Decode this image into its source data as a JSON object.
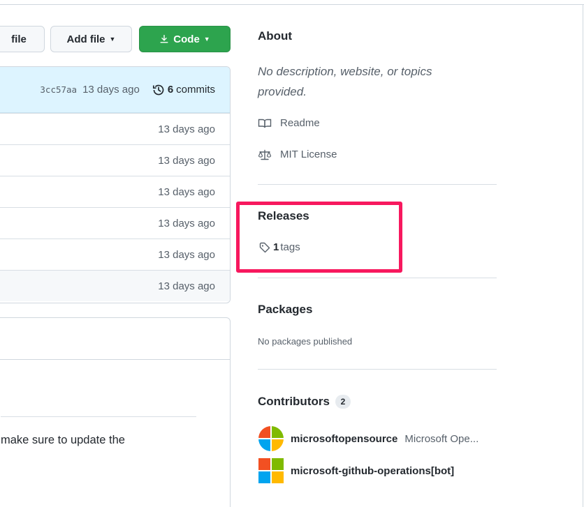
{
  "toolbar": {
    "goto_label": "Go to file",
    "goto_visible": "file",
    "add_label": "Add file",
    "code_label": "Code"
  },
  "latest_commit": {
    "sha": "3cc57aa",
    "time": "13 days ago",
    "commits_count": "6",
    "commits_label": "commits"
  },
  "file_rows": [
    {
      "time": "13 days ago"
    },
    {
      "time": "13 days ago"
    },
    {
      "time": "13 days ago"
    },
    {
      "time": "13 days ago"
    },
    {
      "time": "13 days ago"
    },
    {
      "time": "13 days ago"
    }
  ],
  "readme": {
    "visible_text": "make sure to update the"
  },
  "about": {
    "title": "About",
    "description": "No description, website, or topics provided.",
    "readme_link": "Readme",
    "license_link": "MIT License"
  },
  "releases": {
    "title": "Releases",
    "tags_count": "1",
    "tags_label": "tags"
  },
  "packages": {
    "title": "Packages",
    "empty_text": "No packages published"
  },
  "contributors": {
    "title": "Contributors",
    "count": "2",
    "items": [
      {
        "login": "microsoftopensource",
        "full_name": "Microsoft Ope..."
      },
      {
        "login": "microsoft-github-operations[bot]",
        "full_name": ""
      }
    ]
  },
  "colors": {
    "accent_green": "#2da44e",
    "highlight": "#f7185e",
    "commit_bar": "#ddf4ff",
    "ms_red": "#f25022",
    "ms_green": "#7fba00",
    "ms_blue": "#00a4ef",
    "ms_yellow": "#ffb900"
  }
}
